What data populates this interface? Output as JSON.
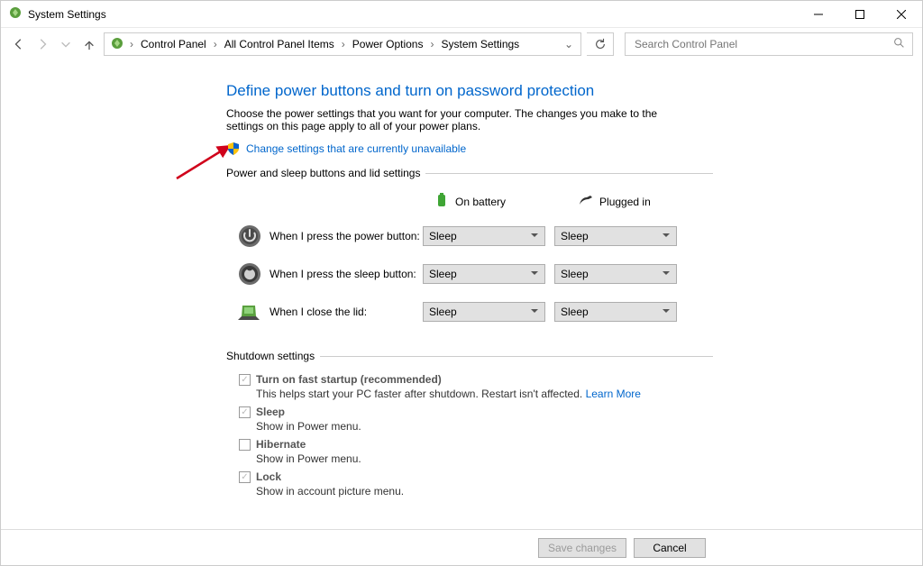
{
  "window": {
    "title": "System Settings"
  },
  "breadcrumbs": [
    "Control Panel",
    "All Control Panel Items",
    "Power Options",
    "System Settings"
  ],
  "search": {
    "placeholder": "Search Control Panel"
  },
  "page": {
    "heading": "Define power buttons and turn on password protection",
    "subtext": "Choose the power settings that you want for your computer. The changes you make to the settings on this page apply to all of your power plans.",
    "admin_link": "Change settings that are currently unavailable"
  },
  "group_buttons_lid": {
    "legend": "Power and sleep buttons and lid settings",
    "col_battery": "On battery",
    "col_plugged": "Plugged in",
    "rows": [
      {
        "label": "When I press the power button:",
        "battery": "Sleep",
        "plugged": "Sleep"
      },
      {
        "label": "When I press the sleep button:",
        "battery": "Sleep",
        "plugged": "Sleep"
      },
      {
        "label": "When I close the lid:",
        "battery": "Sleep",
        "plugged": "Sleep"
      }
    ]
  },
  "group_shutdown": {
    "legend": "Shutdown settings",
    "items": [
      {
        "title": "Turn on fast startup (recommended)",
        "checked": true,
        "desc": "This helps start your PC faster after shutdown. Restart isn't affected. ",
        "learn": "Learn More"
      },
      {
        "title": "Sleep",
        "checked": true,
        "desc": "Show in Power menu."
      },
      {
        "title": "Hibernate",
        "checked": false,
        "desc": "Show in Power menu."
      },
      {
        "title": "Lock",
        "checked": true,
        "desc": "Show in account picture menu."
      }
    ]
  },
  "footer": {
    "save": "Save changes",
    "cancel": "Cancel"
  }
}
